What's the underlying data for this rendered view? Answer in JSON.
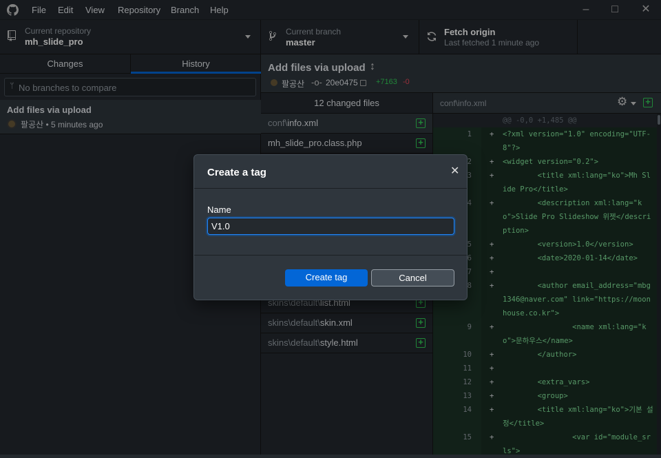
{
  "menu": [
    "File",
    "Edit",
    "View",
    "Repository",
    "Branch",
    "Help"
  ],
  "toolbar": {
    "repo_label": "Current repository",
    "repo_name": "mh_slide_pro",
    "branch_label": "Current branch",
    "branch_name": "master",
    "fetch_title": "Fetch origin",
    "fetch_sub": "Last fetched 1 minute ago"
  },
  "sidebar": {
    "tabs": [
      "Changes",
      "History"
    ],
    "branch_placeholder": "No branches to compare",
    "commit_title": "Add files via upload",
    "commit_meta": "팔공산 • 5 minutes ago"
  },
  "commit_header": {
    "title": "Add files via upload",
    "author": "팔공산",
    "sha": "20e0475",
    "additions": "+7163",
    "deletions": "-0"
  },
  "files": {
    "count_label": "12 changed files",
    "top": [
      {
        "dir": "conf\\",
        "name": "info.xml"
      },
      {
        "dir": "",
        "name": "mh_slide_pro.class.php"
      }
    ],
    "bottom": [
      {
        "dir": "skins\\default\\",
        "name": "list.html"
      },
      {
        "dir": "skins\\default\\",
        "name": "skin.xml"
      },
      {
        "dir": "skins\\default\\",
        "name": "style.html"
      }
    ]
  },
  "diff": {
    "path": "conf\\info.xml",
    "hunk": "@@ -0,0 +1,485 @@",
    "lines": [
      {
        "n": "1",
        "code": "<?xml version=\"1.0\" encoding=\"UTF-8\"?>"
      },
      {
        "n": "2",
        "code": "<widget version=\"0.2\">"
      },
      {
        "n": "3",
        "code": "        <title xml:lang=\"ko\">Mh Slide Pro</title>"
      },
      {
        "n": "4",
        "code": "        <description xml:lang=\"ko\">Slide Pro Slideshow 위젯</description>"
      },
      {
        "n": "5",
        "code": "        <version>1.0</version>"
      },
      {
        "n": "6",
        "code": "        <date>2020-01-14</date>"
      },
      {
        "n": "7",
        "code": ""
      },
      {
        "n": "8",
        "code": "        <author email_address=\"mbg1346@naver.com\" link=\"https://moonhouse.co.kr\">"
      },
      {
        "n": "9",
        "code": "                <name xml:lang=\"ko\">문하우스</name>"
      },
      {
        "n": "10",
        "code": "        </author>"
      },
      {
        "n": "11",
        "code": ""
      },
      {
        "n": "12",
        "code": "        <extra_vars>"
      },
      {
        "n": "13",
        "code": "        <group>"
      },
      {
        "n": "14",
        "code": "        <title xml:lang=\"ko\">기본 설정</title>"
      },
      {
        "n": "15",
        "code": "                <var id=\"module_srls\">"
      }
    ]
  },
  "dialog": {
    "title": "Create a tag",
    "name_label": "Name",
    "name_value": "V1.0",
    "create_label": "Create tag",
    "cancel_label": "Cancel"
  },
  "colors": {
    "accent": "#0366d6",
    "added": "#34d058",
    "removed": "#ea4a5a"
  }
}
